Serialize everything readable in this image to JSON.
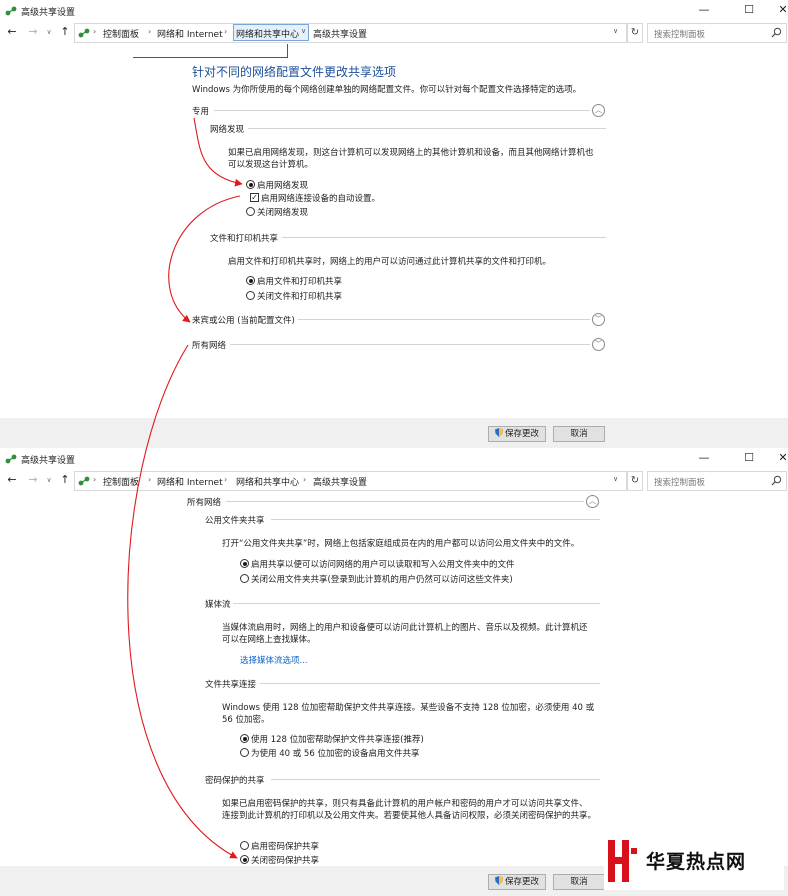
{
  "window1": {
    "title": "高级共享设置",
    "controls": [
      "—",
      "☐",
      "✕"
    ],
    "breadcrumbs": [
      "控制面板",
      "网络和 Internet",
      "网络和共享中心",
      "高级共享设置"
    ],
    "search_placeholder": "搜索控制面板",
    "heading": "针对不同的网络配置文件更改共享选项",
    "description": "Windows 为你所使用的每个网络创建单独的网络配置文件。你可以针对每个配置文件选择特定的选项。",
    "profile_private": "专用",
    "network_discovery": {
      "title": "网络发现",
      "desc_line1": "如果已启用网络发现，则这台计算机可以发现网络上的其他计算机和设备，而且其他网络计算机也",
      "desc_line2": "可以发现这台计算机。",
      "opt_on": "启用网络发现",
      "opt_on_selected": true,
      "auto_setup": "启用网络连接设备的自动设置。",
      "auto_setup_checked": true,
      "opt_off": "关闭网络发现"
    },
    "file_printer": {
      "title": "文件和打印机共享",
      "desc": "启用文件和打印机共享时，网络上的用户可以访问通过此计算机共享的文件和打印机。",
      "opt_on": "启用文件和打印机共享",
      "opt_on_selected": true,
      "opt_off": "关闭文件和打印机共享"
    },
    "profile_guest": "来宾或公用 (当前配置文件)",
    "profile_all": "所有网络",
    "save_label": "保存更改",
    "cancel_label": "取消"
  },
  "window2": {
    "title": "高级共享设置",
    "breadcrumbs": [
      "控制面板",
      "网络和 Internet",
      "网络和共享中心",
      "高级共享设置"
    ],
    "search_placeholder": "搜索控制面板",
    "profile_all": "所有网络",
    "public_folder": {
      "title": "公用文件夹共享",
      "desc": "打开“公用文件夹共享”时，网络上包括家庭组成员在内的用户都可以访问公用文件夹中的文件。",
      "opt_on": "启用共享以便可以访问网络的用户可以读取和写入公用文件夹中的文件",
      "opt_on_selected": true,
      "opt_off": "关闭公用文件夹共享(登录到此计算机的用户仍然可以访问这些文件夹)"
    },
    "media": {
      "title": "媒体流",
      "desc_line1": "当媒体流启用时，网络上的用户和设备便可以访问此计算机上的图片、音乐以及视频。此计算机还",
      "desc_line2": "可以在网络上查找媒体。",
      "link": "选择媒体流选项..."
    },
    "file_sharing_conn": {
      "title": "文件共享连接",
      "desc_line1": "Windows 使用 128 位加密帮助保护文件共享连接。某些设备不支持 128 位加密，必须使用 40 或",
      "desc_line2": "56 位加密。",
      "opt_128": "使用 128 位加密帮助保护文件共享连接(推荐)",
      "opt_128_selected": true,
      "opt_40": "为使用 40 或 56 位加密的设备启用文件共享"
    },
    "password": {
      "title": "密码保护的共享",
      "desc_line1": "如果已启用密码保护的共享，则只有具备此计算机的用户帐户和密码的用户才可以访问共享文件、",
      "desc_line2": "连接到此计算机的打印机以及公用文件夹。若要使其他人具备访问权限，必须关闭密码保护的共享。",
      "opt_on": "启用密码保护共享",
      "opt_off": "关闭密码保护共享",
      "opt_off_selected": true
    },
    "save_label": "保存更改",
    "cancel_label": "取消"
  },
  "watermark": "华夏热点网",
  "colors": {
    "heading": "#1f4e99",
    "link": "#0f64c8",
    "annotation_arrow": "#e0191e",
    "watermark_red": "#d7101c"
  }
}
